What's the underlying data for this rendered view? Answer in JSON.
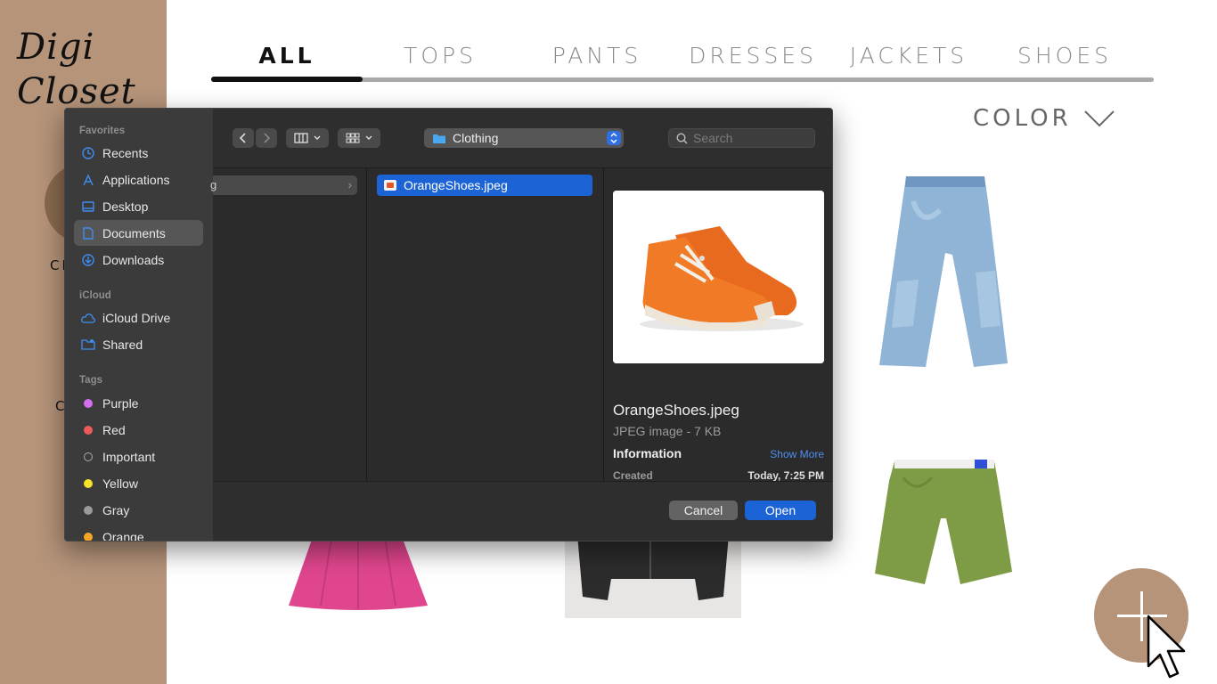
{
  "app": {
    "logo_line1": "Digi",
    "logo_line2": "Closet",
    "sidebar_label_closet": "CLOSET",
    "sidebar_label_partial": "C",
    "brand_color": "#b5947a"
  },
  "tabs": [
    {
      "label": "ALL",
      "active": true
    },
    {
      "label": "TOPS",
      "active": false
    },
    {
      "label": "PANTS",
      "active": false
    },
    {
      "label": "DRESSES",
      "active": false
    },
    {
      "label": "JACKETS",
      "active": false
    },
    {
      "label": "SHOES",
      "active": false
    }
  ],
  "filter": {
    "color_label": "COLOR",
    "icon": "chevron-down-icon"
  },
  "add_button": {
    "icon": "plus-icon"
  },
  "dialog": {
    "sidebar": {
      "favorites_heading": "Favorites",
      "favorites": [
        {
          "label": "Recents",
          "icon": "clock-icon"
        },
        {
          "label": "Applications",
          "icon": "applications-icon"
        },
        {
          "label": "Desktop",
          "icon": "desktop-icon"
        },
        {
          "label": "Documents",
          "icon": "document-icon",
          "selected": true
        },
        {
          "label": "Downloads",
          "icon": "download-icon"
        }
      ],
      "icloud_heading": "iCloud",
      "icloud": [
        {
          "label": "iCloud Drive",
          "icon": "cloud-icon"
        },
        {
          "label": "Shared",
          "icon": "shared-folder-icon"
        }
      ],
      "tags_heading": "Tags",
      "tags": [
        {
          "label": "Purple",
          "color": "#d56ef0"
        },
        {
          "label": "Red",
          "color": "#ee5a5a"
        },
        {
          "label": "Important",
          "color": "none"
        },
        {
          "label": "Yellow",
          "color": "#f5e12a"
        },
        {
          "label": "Gray",
          "color": "#9a9a9a"
        },
        {
          "label": "Orange",
          "color": "#f5a623"
        }
      ]
    },
    "toolbar": {
      "current_folder": "Clothing",
      "search_placeholder": "Search"
    },
    "column1_row_fragment": "g",
    "selected_file": "OrangeShoes.jpeg",
    "preview": {
      "name": "OrangeShoes.jpeg",
      "kind": "JPEG image - 7 KB",
      "info_heading": "Information",
      "show_more": "Show More",
      "created_label": "Created",
      "created_value": "Today, 7:25 PM"
    },
    "buttons": {
      "cancel": "Cancel",
      "open": "Open"
    }
  }
}
